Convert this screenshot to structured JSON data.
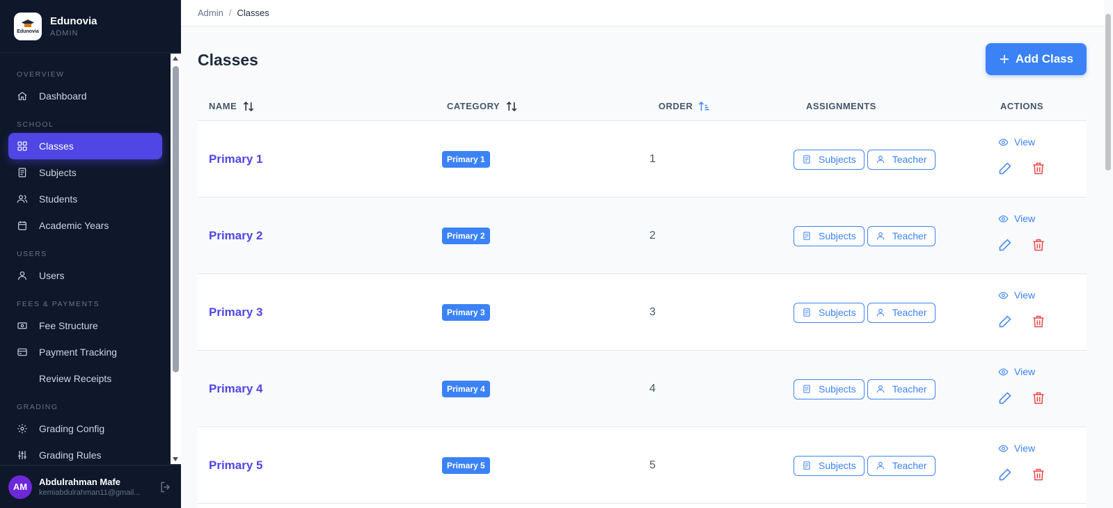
{
  "brand": {
    "name": "Edunovia",
    "role": "ADMIN",
    "logo_text": "Edunovia"
  },
  "sidebar": {
    "sections": [
      {
        "title": "OVERVIEW",
        "items": [
          {
            "label": "Dashboard",
            "icon": "home-icon",
            "active": false
          }
        ]
      },
      {
        "title": "SCHOOL",
        "items": [
          {
            "label": "Classes",
            "icon": "grid-icon",
            "active": true
          },
          {
            "label": "Subjects",
            "icon": "book-icon",
            "active": false
          },
          {
            "label": "Students",
            "icon": "users-icon",
            "active": false
          },
          {
            "label": "Academic Years",
            "icon": "calendar-icon",
            "active": false
          }
        ]
      },
      {
        "title": "USERS",
        "items": [
          {
            "label": "Users",
            "icon": "user-icon",
            "active": false
          }
        ]
      },
      {
        "title": "FEES & PAYMENTS",
        "items": [
          {
            "label": "Fee Structure",
            "icon": "money-icon",
            "active": false
          },
          {
            "label": "Payment Tracking",
            "icon": "credit-card-icon",
            "active": false
          },
          {
            "label": "Review Receipts",
            "icon": "",
            "active": false
          }
        ]
      },
      {
        "title": "GRADING",
        "items": [
          {
            "label": "Grading Config",
            "icon": "gear-icon",
            "active": false
          },
          {
            "label": "Grading Rules",
            "icon": "sliders-icon",
            "active": false
          }
        ]
      }
    ]
  },
  "user": {
    "initials": "AM",
    "name": "Abdulrahman Mafe",
    "email": "kemiabdulrahman11@gmail..."
  },
  "breadcrumb": {
    "root": "Admin",
    "separator": "/",
    "current": "Classes"
  },
  "page": {
    "title": "Classes",
    "add_button": "Add Class"
  },
  "table": {
    "headers": {
      "name": "NAME",
      "category": "CATEGORY",
      "order": "ORDER",
      "assignments": "ASSIGNMENTS",
      "actions": "ACTIONS"
    },
    "rows": [
      {
        "name": "Primary 1",
        "category": "Primary 1",
        "order": "1"
      },
      {
        "name": "Primary 2",
        "category": "Primary 2",
        "order": "2"
      },
      {
        "name": "Primary 3",
        "category": "Primary 3",
        "order": "3"
      },
      {
        "name": "Primary 4",
        "category": "Primary 4",
        "order": "4"
      },
      {
        "name": "Primary 5",
        "category": "Primary 5",
        "order": "5"
      }
    ],
    "subjects_label": "Subjects",
    "teacher_label": "Teacher",
    "view_label": "View"
  },
  "colors": {
    "sidebar_bg": "#0f172a",
    "active_nav": "#4f46e5",
    "primary": "#3b82f6",
    "link": "#4f46e5",
    "danger": "#ef4444"
  }
}
